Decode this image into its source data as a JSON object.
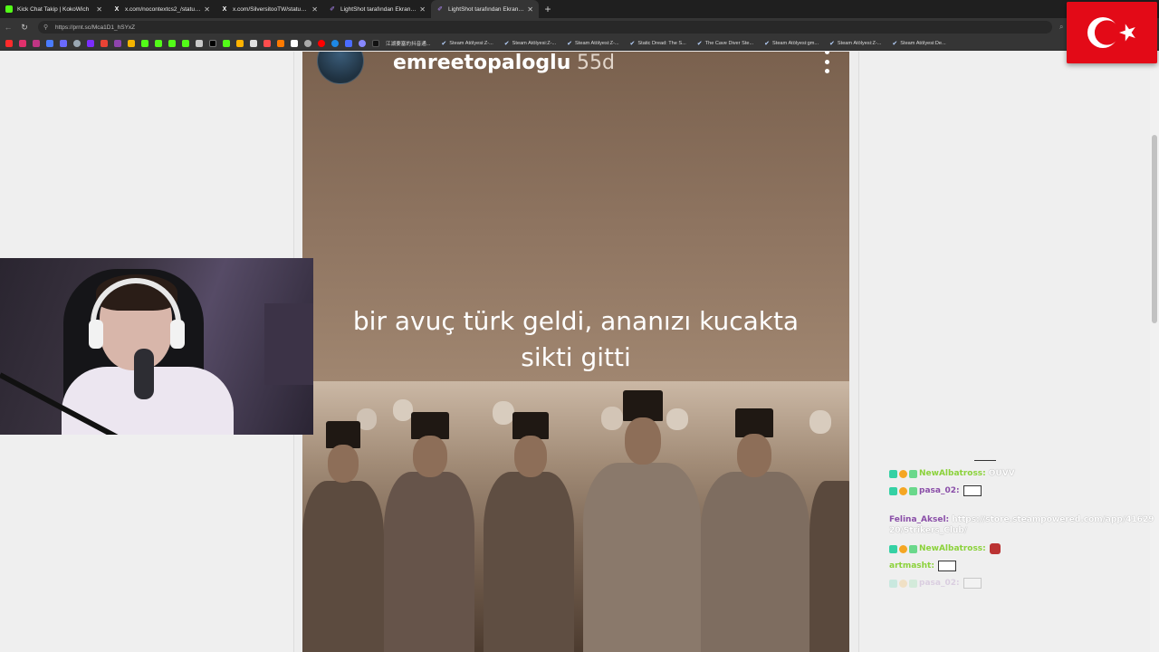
{
  "browser": {
    "tabs": [
      {
        "title": "Kick Chat Takip | KokoWich",
        "icon": "kick-icon",
        "active": false
      },
      {
        "title": "x.com/nocontextcs2_/status/20938...",
        "icon": "x-icon",
        "active": false
      },
      {
        "title": "x.com/SilversitooTW/status/20937...",
        "icon": "x-icon",
        "active": false
      },
      {
        "title": "LightShot tarafından Ekran Görünt...",
        "icon": "lightshot-icon",
        "active": false
      },
      {
        "title": "LightShot tarafından Ekran Görünt...",
        "icon": "lightshot-icon",
        "active": true
      }
    ],
    "url": "https://prnt.sc/Mca1D1_hSYxZ",
    "bookmarks": [
      "江湖要塞的抖音通...",
      "Steam Atölyesi:Z-...",
      "Steam Atölyesi:Z-...",
      "Steam Atölyesi:Z-...",
      "Static Dread: The S...",
      "The Cave Diver Ste...",
      "Steam Atölyesi:gm...",
      "Steam Atölyesi:Z-...",
      "Steam Atölyesi:De..."
    ],
    "colors": {
      "tabbar": "#1f1f1f",
      "toolbar": "#353535"
    }
  },
  "story": {
    "username": "emreetopaloglu",
    "age": "55d",
    "caption_line1": "bir avuç türk geldi, ananızı kucakta",
    "caption_line2": "sikti gitti"
  },
  "chat": {
    "messages": [
      {
        "user": "NewAlbatross:",
        "text": "OUVV",
        "color": "green"
      },
      {
        "user": "pasa_02:",
        "text": "",
        "emote": true,
        "color": "purple"
      },
      {
        "user": "Felina_Aksel:",
        "text": "https://store.steampowered.com/app/4162920/Strikers_Club/",
        "color": "purple"
      },
      {
        "user": "NewAlbatross:",
        "text": "",
        "emote": true,
        "color": "green"
      },
      {
        "user": "artmasht:",
        "text": "",
        "emote": true,
        "color": "green"
      },
      {
        "user": "pasa_02:",
        "text": "",
        "emote": true,
        "color": "faded"
      }
    ]
  },
  "overlay": {
    "flag": "turkish-flag",
    "flag_colors": {
      "red": "#e30a17",
      "white": "#ffffff"
    }
  }
}
